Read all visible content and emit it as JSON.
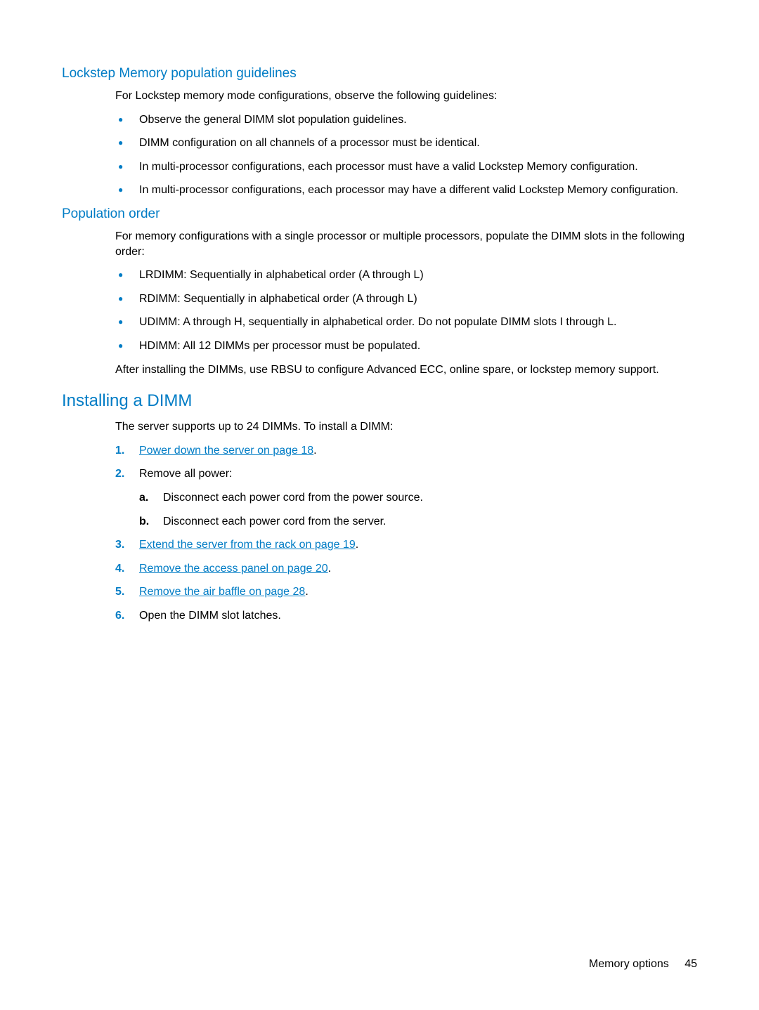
{
  "sections": {
    "lockstep": {
      "title": "Lockstep Memory population guidelines",
      "intro": "For Lockstep memory mode configurations, observe the following guidelines:",
      "bullets": [
        "Observe the general DIMM slot population guidelines.",
        "DIMM configuration on all channels of a processor must be identical.",
        "In multi-processor configurations, each processor must have a valid Lockstep Memory configuration.",
        "In multi-processor configurations, each processor may have a different valid Lockstep Memory configuration."
      ]
    },
    "poporder": {
      "title": "Population order",
      "intro": "For memory configurations with a single processor or multiple processors, populate the DIMM slots in the following order:",
      "bullets": [
        "LRDIMM: Sequentially in alphabetical order (A through L)",
        "RDIMM: Sequentially in alphabetical order (A through L)",
        "UDIMM: A through H, sequentially in alphabetical order. Do not populate DIMM slots I through L.",
        "HDIMM: All 12 DIMMs per processor must be populated."
      ],
      "after": "After installing the DIMMs, use RBSU to configure Advanced ECC, online spare, or lockstep memory support."
    },
    "install": {
      "title": "Installing a DIMM",
      "intro": "The server supports up to 24 DIMMs. To install a DIMM:",
      "steps": {
        "s1_link": "Power down the server on page 18",
        "s2_text": "Remove all power:",
        "s2a": "Disconnect each power cord from the power source.",
        "s2b": "Disconnect each power cord from the server.",
        "s3_link": "Extend the server from the rack on page 19",
        "s4_link": "Remove the access panel on page 20",
        "s5_link": "Remove the air baffle on page 28",
        "s6_text": "Open the DIMM slot latches."
      }
    }
  },
  "footer": {
    "section": "Memory options",
    "page": "45"
  },
  "punct": {
    "period": "."
  }
}
